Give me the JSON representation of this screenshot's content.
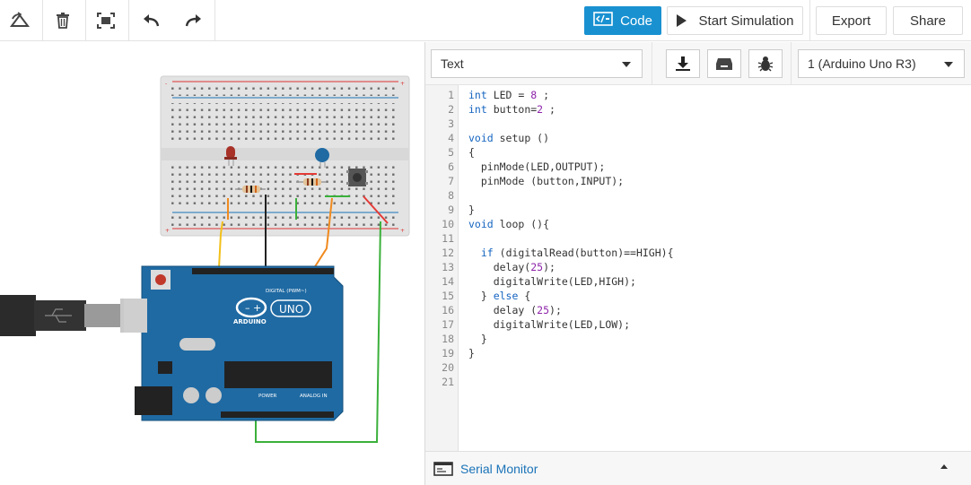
{
  "toolbar": {
    "icons": [
      "rotate-icon",
      "delete-icon",
      "fit-view-icon",
      "undo-icon",
      "redo-icon"
    ],
    "code_label": "Code",
    "start_simulation_label": "Start Simulation",
    "export_label": "Export",
    "share_label": "Share"
  },
  "circuit": {
    "board_brand": "ARDUINO",
    "board_model": "UNO",
    "digital_label": "DIGITAL (PWM~)",
    "power_label": "POWER",
    "analog_label": "ANALOG IN",
    "wire_colors": {
      "yellow": "#f2c01a",
      "black": "#222222",
      "orange": "#f08a1e",
      "green": "#3ab03a",
      "red": "#e53935"
    }
  },
  "code_panel": {
    "mode_select": "Text",
    "device_select": "1 (Arduino Uno R3)",
    "code_lines": [
      [
        [
          "kw",
          "int"
        ],
        [
          "t",
          " LED = "
        ],
        [
          "num",
          "8"
        ],
        [
          "t",
          " ;"
        ]
      ],
      [
        [
          "kw",
          "int"
        ],
        [
          "t",
          " button="
        ],
        [
          "num",
          "2"
        ],
        [
          "t",
          " ;"
        ]
      ],
      [],
      [
        [
          "kw",
          "void"
        ],
        [
          "t",
          " setup ()"
        ]
      ],
      [
        [
          "t",
          "{"
        ]
      ],
      [
        [
          "t",
          "  pinMode(LED,OUTPUT);"
        ]
      ],
      [
        [
          "t",
          "  pinMode (button,INPUT);"
        ]
      ],
      [],
      [
        [
          "t",
          "}"
        ]
      ],
      [
        [
          "kw",
          "void"
        ],
        [
          "t",
          " loop (){"
        ]
      ],
      [],
      [
        [
          "t",
          "  "
        ],
        [
          "kw",
          "if"
        ],
        [
          "t",
          " (digitalRead(button)==HIGH){"
        ]
      ],
      [
        [
          "t",
          "    delay("
        ],
        [
          "num",
          "25"
        ],
        [
          "t",
          ");"
        ]
      ],
      [
        [
          "t",
          "    digitalWrite(LED,HIGH);"
        ]
      ],
      [
        [
          "t",
          "  } "
        ],
        [
          "kw",
          "else"
        ],
        [
          "t",
          " {"
        ]
      ],
      [
        [
          "t",
          "    delay ("
        ],
        [
          "num",
          "25"
        ],
        [
          "t",
          ");"
        ]
      ],
      [
        [
          "t",
          "    digitalWrite(LED,LOW);"
        ]
      ],
      [
        [
          "t",
          "  }"
        ]
      ],
      [
        [
          "t",
          "}"
        ]
      ],
      [],
      []
    ],
    "serial_monitor_label": "Serial Monitor"
  },
  "colors": {
    "accent": "#1991d1",
    "keyword": "#1565c0",
    "number": "#8e24aa",
    "board": "#1f6aa3"
  }
}
